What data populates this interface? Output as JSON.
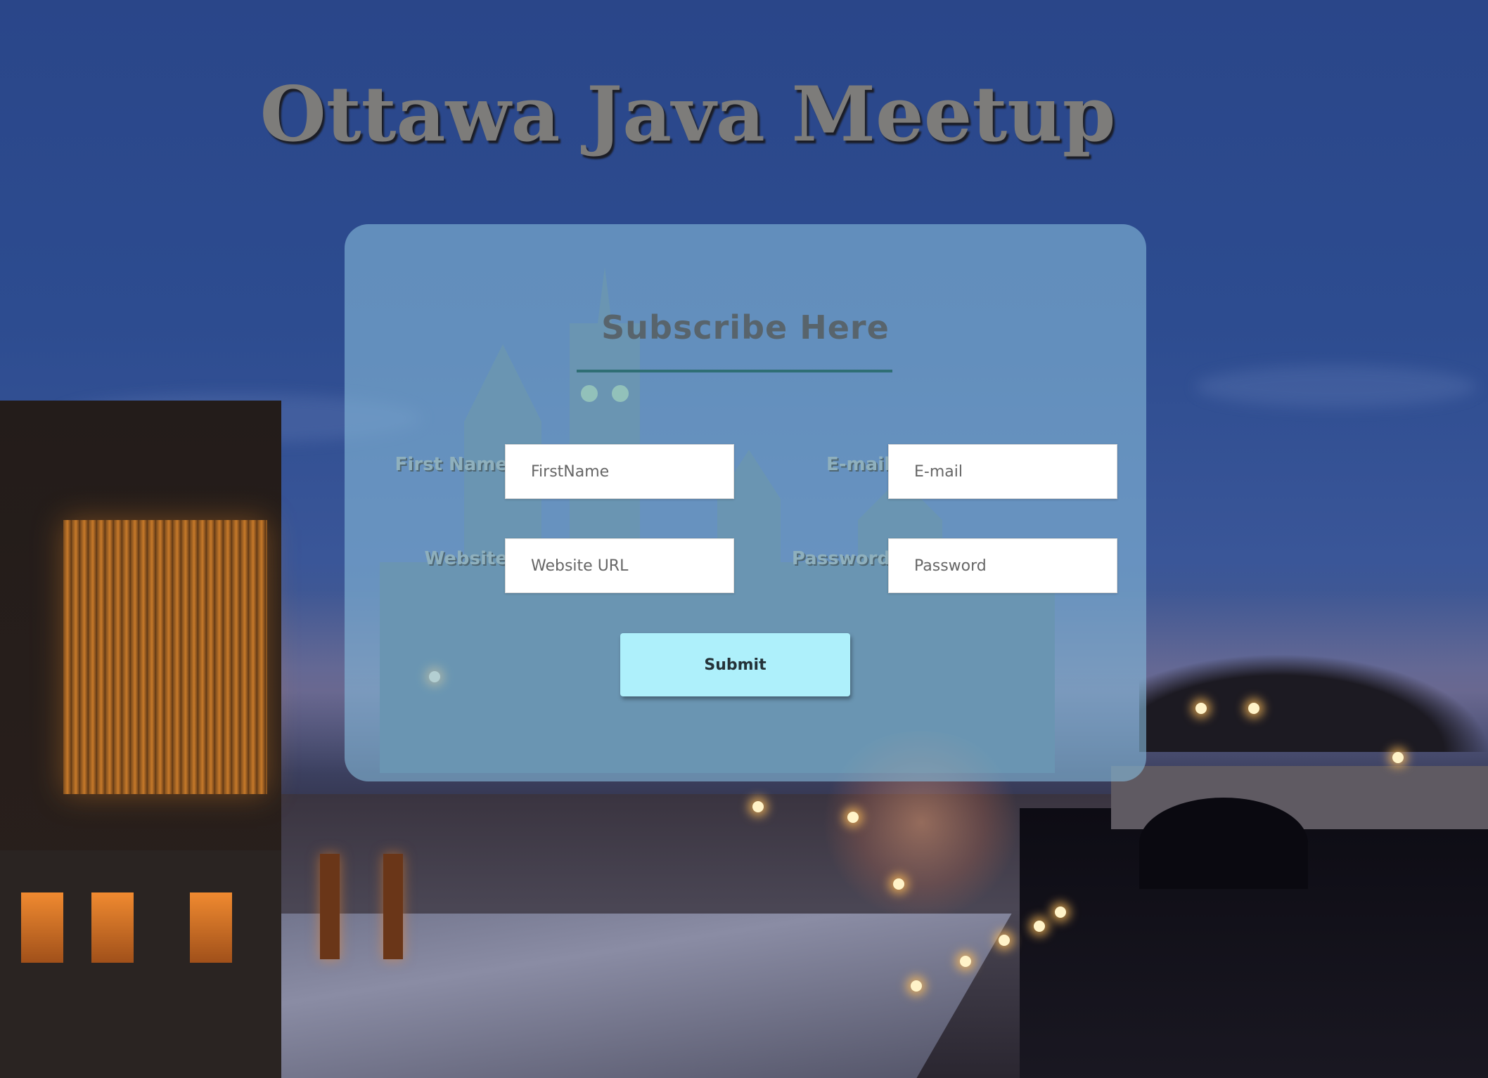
{
  "page": {
    "title": "Ottawa Java Meetup"
  },
  "form": {
    "heading": "Subscribe Here",
    "fields": [
      {
        "label": "First Name",
        "placeholder": "FirstName",
        "value": ""
      },
      {
        "label": "E-mail",
        "placeholder": "E-mail",
        "value": ""
      },
      {
        "label": "Website",
        "placeholder": "Website URL",
        "value": ""
      },
      {
        "label": "Password",
        "placeholder": "Password",
        "value": ""
      }
    ],
    "submit_label": "Submit"
  },
  "colors": {
    "title_text": "#7d7c7a",
    "panel_background": "#84b8d8",
    "heading_underline": "#2f6e74",
    "submit_button": "#aef0fb"
  }
}
